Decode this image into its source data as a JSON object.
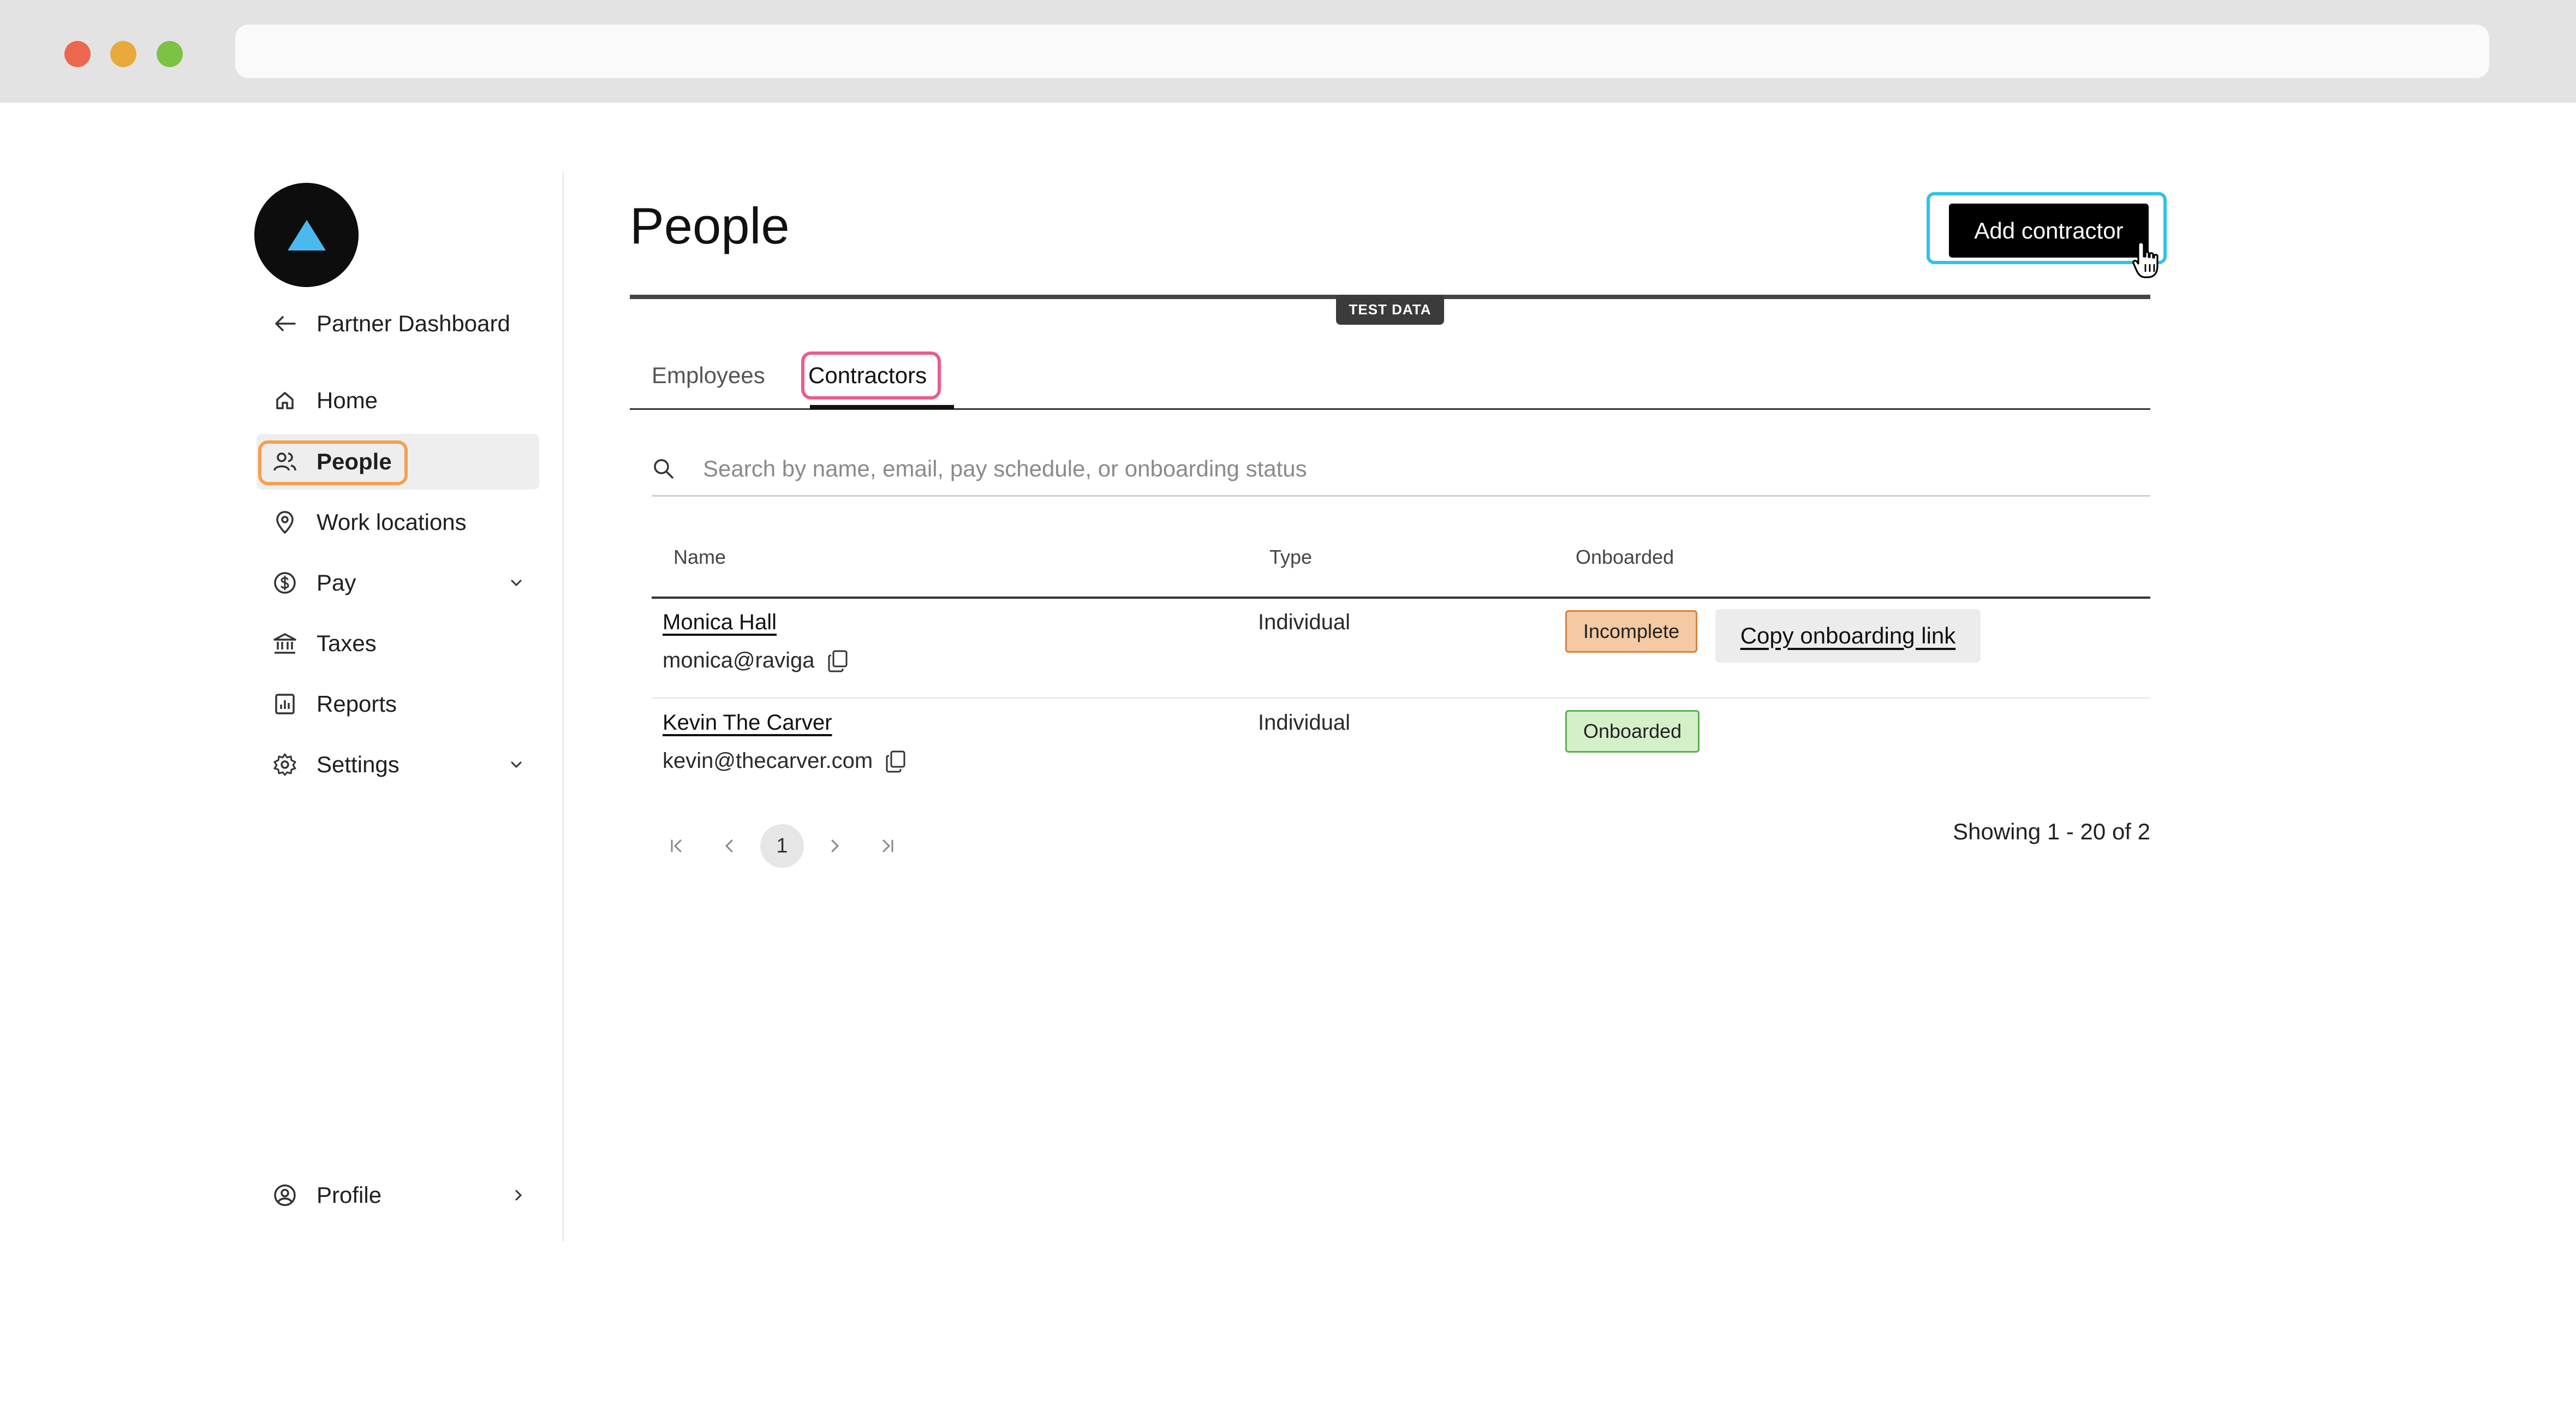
{
  "browser": {
    "dots": [
      "#ec6650",
      "#e9a93a",
      "#7cc244"
    ]
  },
  "sidebar": {
    "back_label": "Partner Dashboard",
    "items": [
      {
        "label": "Home",
        "icon": "home-icon"
      },
      {
        "label": "People",
        "icon": "people-icon",
        "active": true
      },
      {
        "label": "Work locations",
        "icon": "map-pin-icon"
      },
      {
        "label": "Pay",
        "icon": "dollar-icon",
        "expandable": true
      },
      {
        "label": "Taxes",
        "icon": "bank-icon"
      },
      {
        "label": "Reports",
        "icon": "chart-icon"
      },
      {
        "label": "Settings",
        "icon": "gear-icon",
        "expandable": true
      }
    ],
    "profile_label": "Profile"
  },
  "header": {
    "title": "People",
    "add_button": "Add contractor",
    "badge": "TEST DATA"
  },
  "tabs": [
    {
      "label": "Employees",
      "active": false
    },
    {
      "label": "Contractors",
      "active": true
    }
  ],
  "search": {
    "placeholder": "Search by name, email, pay schedule, or onboarding status"
  },
  "table": {
    "headers": [
      "Name",
      "Type",
      "Onboarded"
    ],
    "rows": [
      {
        "name": "Monica Hall",
        "email": "monica@raviga",
        "type": "Individual",
        "status": "Incomplete",
        "action": "Copy onboarding link"
      },
      {
        "name": "Kevin The Carver",
        "email": "kevin@thecarver.com",
        "type": "Individual",
        "status": "Onboarded"
      }
    ]
  },
  "pagination": {
    "current_page": "1",
    "showing": "Showing 1 - 20 of 2"
  },
  "colors": {
    "accent_highlight": "#2ec3ea",
    "people_highlight": "#f5a04a",
    "tab_highlight": "#ea5b8f",
    "incomplete_bg": "#f4c9a3",
    "onboarded_bg": "#d4f0c9",
    "logo_triangle": "#4cb8f0"
  }
}
